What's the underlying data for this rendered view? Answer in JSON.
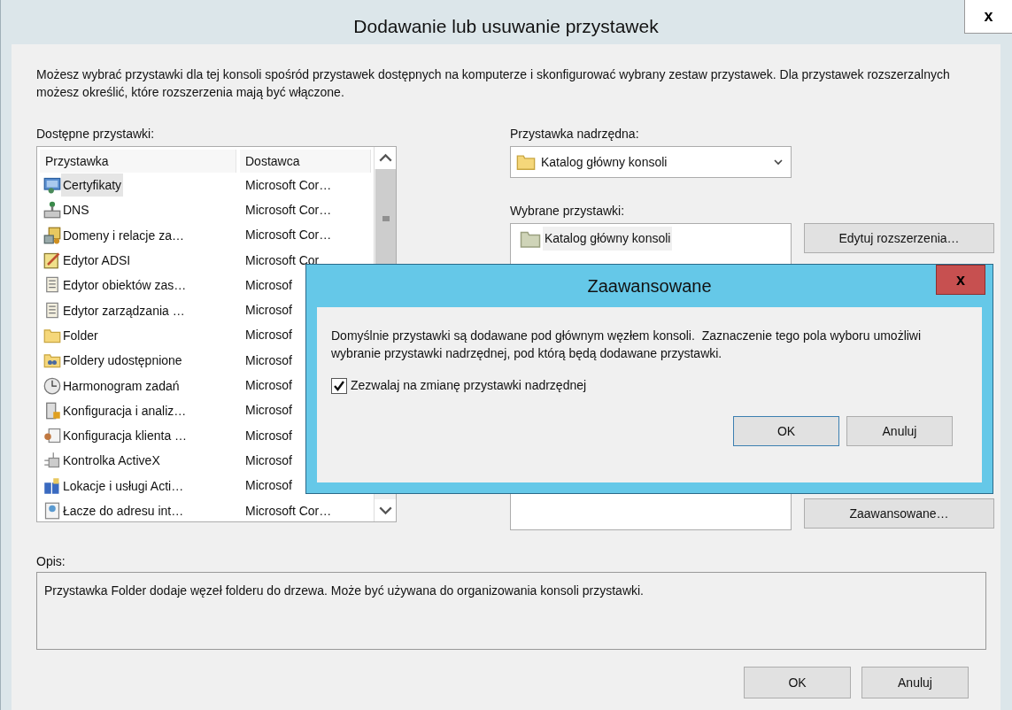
{
  "window": {
    "title": "Dodawanie lub usuwanie przystawek",
    "close": "x"
  },
  "intro": "Możesz wybrać przystawki dla tej konsoli spośród przystawek dostępnych na komputerze i skonfigurować wybrany zestaw przystawek. Dla przystawek rozszerzalnych możesz określić, które rozszerzenia mają być włączone.",
  "available": {
    "label": "Dostępne przystawki:",
    "columns": [
      "Przystawka",
      "Dostawca"
    ],
    "rows": [
      {
        "name": "Certyfikaty",
        "vendor": "Microsoft Cor…",
        "selected": true
      },
      {
        "name": "DNS",
        "vendor": "Microsoft Cor…",
        "selected": false
      },
      {
        "name": "Domeny i relacje za…",
        "vendor": "Microsoft Cor…",
        "selected": false
      },
      {
        "name": "Edytor ADSI",
        "vendor": "Microsoft Cor",
        "selected": false
      },
      {
        "name": "Edytor obiektów zas…",
        "vendor": "Microsof",
        "selected": false
      },
      {
        "name": "Edytor zarządzania …",
        "vendor": "Microsof",
        "selected": false
      },
      {
        "name": "Folder",
        "vendor": "Microsof",
        "selected": false
      },
      {
        "name": "Foldery udostępnione",
        "vendor": "Microsof",
        "selected": false
      },
      {
        "name": "Harmonogram zadań",
        "vendor": "Microsof",
        "selected": false
      },
      {
        "name": "Konfiguracja i analiz…",
        "vendor": "Microsof",
        "selected": false
      },
      {
        "name": "Konfiguracja klienta …",
        "vendor": "Microsof",
        "selected": false
      },
      {
        "name": "Kontrolka ActiveX",
        "vendor": "Microsof",
        "selected": false
      },
      {
        "name": "Lokacje i usługi Acti…",
        "vendor": "Microsof",
        "selected": false
      },
      {
        "name": "Łacze do adresu int…",
        "vendor": "Microsoft Cor…",
        "selected": false
      }
    ]
  },
  "parent": {
    "label": "Przystawka nadrzędna:",
    "value": "Katalog główny konsoli"
  },
  "selected_snapins": {
    "label": "Wybrane przystawki:",
    "items": [
      {
        "name": "Katalog główny konsoli",
        "selected": true
      }
    ]
  },
  "side_buttons": [
    "Edytuj rozszerzenia…",
    "Zaawansowane…"
  ],
  "description": {
    "label": "Opis:",
    "text": "Przystawka Folder dodaje węzeł folderu do drzewa. Może być używana do organizowania konsoli przystawki."
  },
  "buttons": [
    "OK",
    "Anuluj"
  ],
  "dialog": {
    "title": "Zaawansowane",
    "close": "x",
    "text": "Domyślnie przystawki są dodawane pod głównym węzłem konsoli.  Zaznaczenie tego pola wyboru umożliwi wybranie przystawki nadrzędnej, pod którą będą dodawane przystawki.",
    "checkbox": {
      "label": "Zezwalaj na zmianę przystawki nadrzędnej",
      "checked": true
    },
    "buttons": [
      "OK",
      "Anuluj"
    ]
  }
}
